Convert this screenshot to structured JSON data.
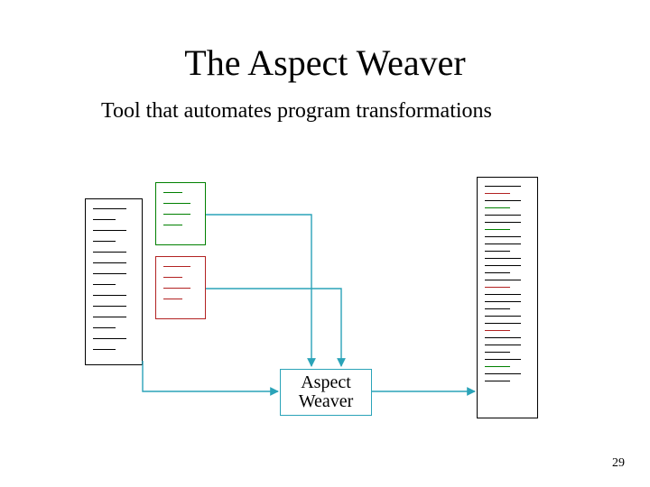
{
  "title": "The Aspect Weaver",
  "subtitle": "Tool that automates program transformations",
  "weaver": {
    "line1": "Aspect",
    "line2": "Weaver"
  },
  "page_number": "29",
  "colors": {
    "arrow": "#2aa3b8",
    "green": "#008000",
    "red": "#b22222",
    "black": "#000000"
  }
}
